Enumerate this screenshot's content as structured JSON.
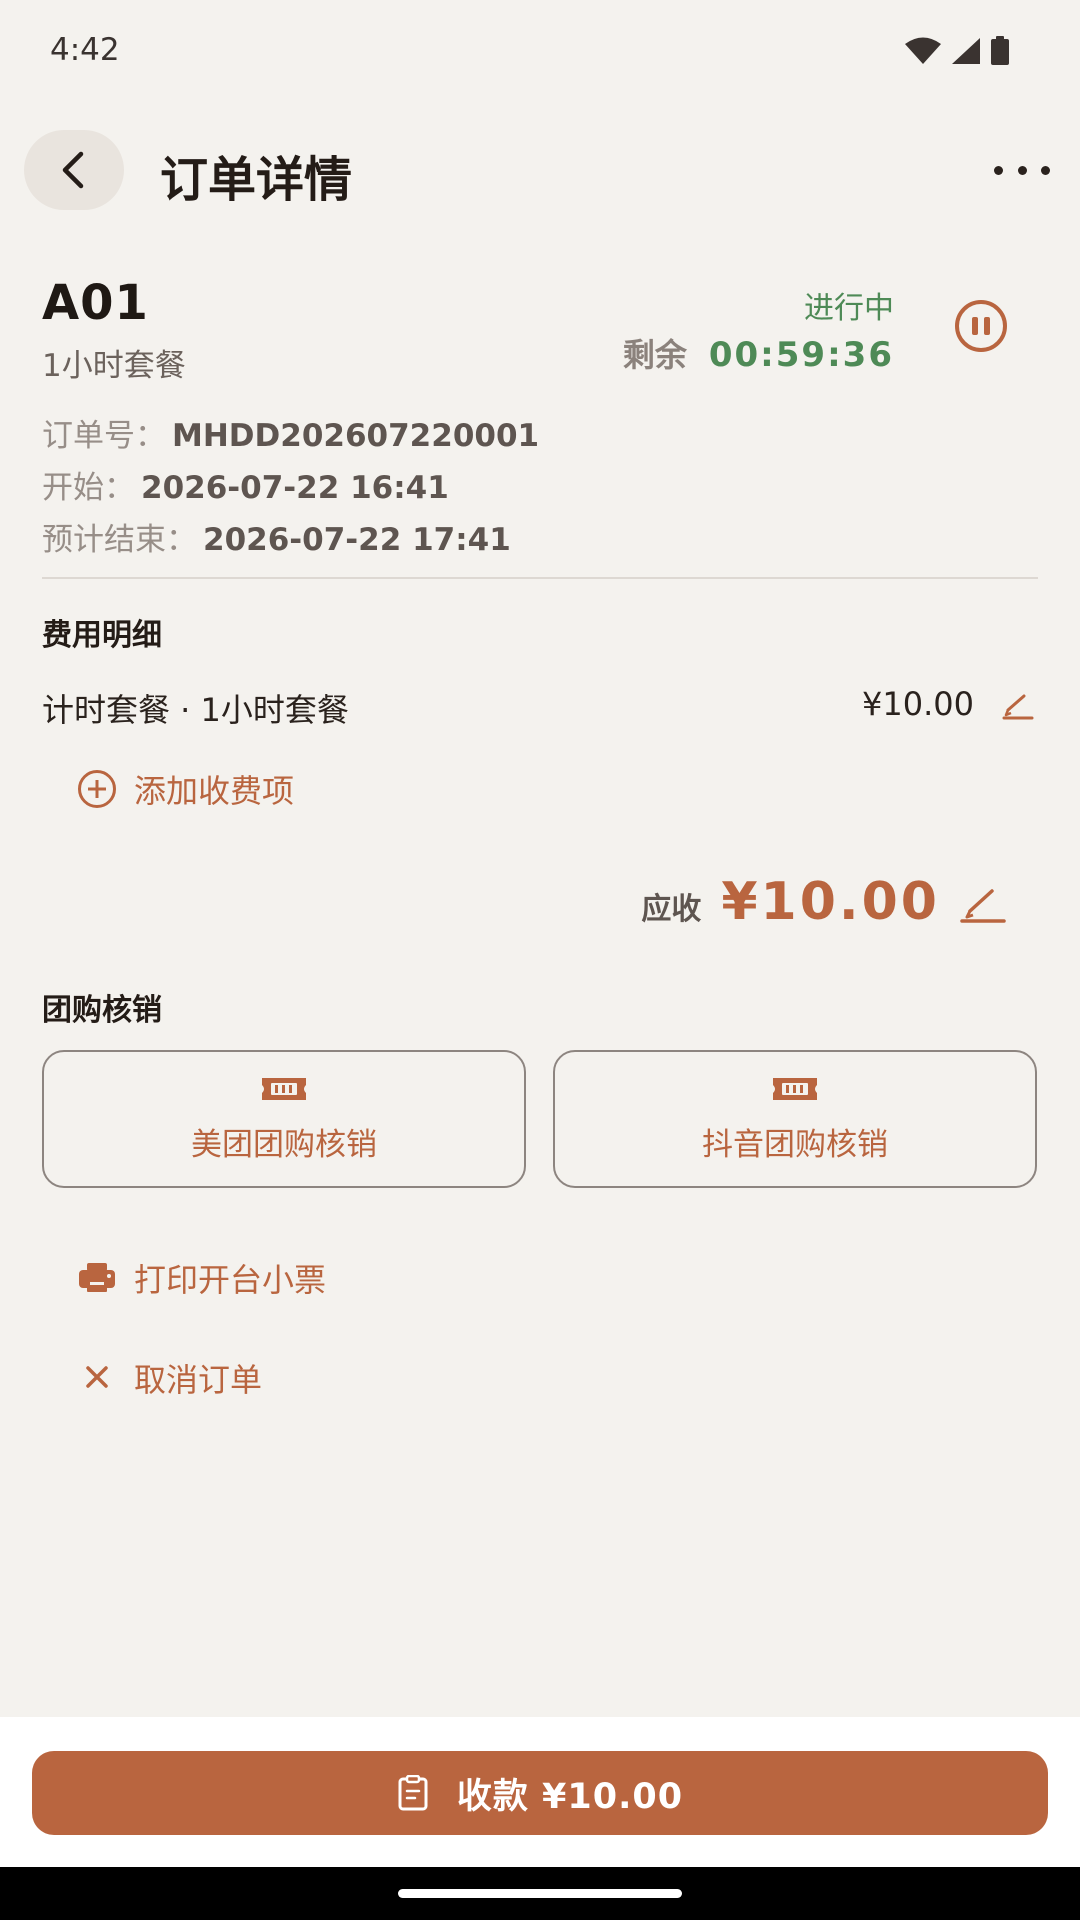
{
  "status_bar": {
    "time": "4:42"
  },
  "header": {
    "title": "订单详情"
  },
  "order": {
    "table_code": "A01",
    "package": "1小时套餐",
    "status": "进行中",
    "remaining_label": "剩余",
    "remaining_time": "00:59:36",
    "number_label": "订单号：",
    "number": "MHDD202607220001",
    "start_label": "开始：",
    "start": "2026-07-22 16:41",
    "end_label": "预计结束：",
    "end": "2026-07-22 17:41"
  },
  "fees": {
    "title": "费用明细",
    "items": [
      {
        "name": "计时套餐 · 1小时套餐",
        "amount": "¥10.00"
      }
    ],
    "add_label": "添加收费项"
  },
  "due": {
    "label": "应收",
    "amount": "¥10.00"
  },
  "group_buy": {
    "title": "团购核销",
    "meituan": "美团团购核销",
    "douyin": "抖音团购核销"
  },
  "actions": {
    "print": "打印开台小票",
    "cancel": "取消订单"
  },
  "pay_button": {
    "label": "收款 ¥10.00"
  },
  "colors": {
    "accent": "#B9653F",
    "status_green": "#4E8A56",
    "background": "#F4F2EE"
  }
}
